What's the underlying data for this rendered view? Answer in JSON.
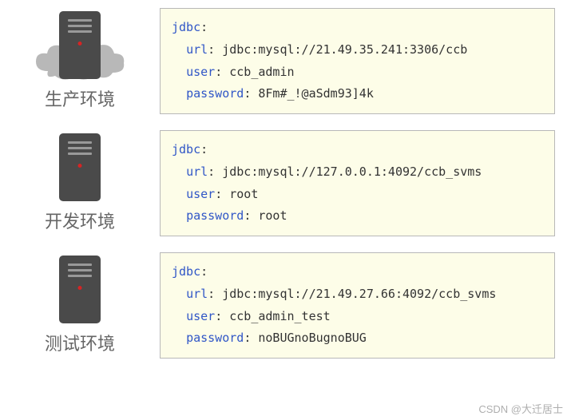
{
  "environments": [
    {
      "label": "生产环境",
      "has_cloud": true,
      "jdbc": {
        "url": "jdbc:mysql://21.49.35.241:3306/ccb",
        "user": "ccb_admin",
        "password": "8Fm#_!@aSdm93]4k"
      }
    },
    {
      "label": "开发环境",
      "has_cloud": false,
      "jdbc": {
        "url": "jdbc:mysql://127.0.0.1:4092/ccb_svms",
        "user": "root",
        "password": "root"
      }
    },
    {
      "label": "测试环境",
      "has_cloud": false,
      "jdbc": {
        "url": "jdbc:mysql://21.49.27.66:4092/ccb_svms",
        "user": "ccb_admin_test",
        "password": "noBUGnoBugnoBUG"
      }
    }
  ],
  "keys": {
    "jdbc": "jdbc",
    "url": "url",
    "user": "user",
    "password": "password"
  },
  "watermark": "CSDN @大迁居士"
}
